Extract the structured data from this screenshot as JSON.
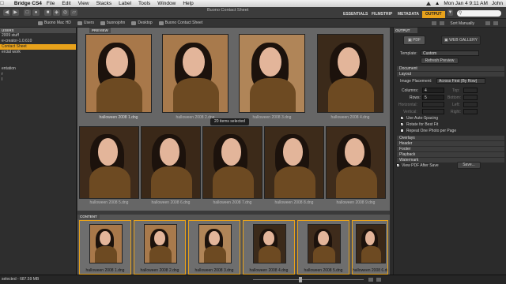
{
  "menubar": {
    "app_name": "Bridge CS4",
    "items": [
      "File",
      "Edit",
      "View",
      "Stacks",
      "Label",
      "Tools",
      "Window",
      "Help"
    ],
    "clock": "Mon Jan 4  9:11 AM",
    "user": "John"
  },
  "toolbar": {
    "window_title": "Buono Contact Sheet",
    "workspaces": [
      "ESSENTIALS",
      "FILMSTRIP",
      "METADATA",
      "OUTPUT"
    ],
    "active_workspace": "OUTPUT",
    "accent": "#e8a21b"
  },
  "pathbar": {
    "crumbs": [
      "Buono Mac HD",
      "Users",
      "buonojohn",
      "Desktop",
      "Buono Contact Sheet"
    ],
    "sort_label": "Sort Manually"
  },
  "left_panel": {
    "tab_label": "USERS",
    "items": [
      "2009 stuff",
      "e-creator-1.0.610",
      "Contact Sheet",
      "ercial work",
      "",
      "",
      "entation",
      "r",
      "l"
    ],
    "selected_index": 2
  },
  "preview": {
    "tab_label": "PREVIEW",
    "selection_count": "20 items selected",
    "top_captions": [
      "halloween 2008 1.dng",
      "halloween 2008 2.dng",
      "halloween 2008 3.dng",
      "halloween 2008 4.dng"
    ],
    "bottom_captions": [
      "halloween 2008 5.dng",
      "halloween 2008 6.dng",
      "halloween 2008 7.dng",
      "halloween 2008 8.dng",
      "halloween 2008 9.dng"
    ]
  },
  "content": {
    "tab_label": "CONTENT",
    "captions": [
      "halloween 2008 1.dng",
      "halloween 2008 2.dng",
      "halloween 2008 3.dng",
      "halloween 2008 4.dng",
      "halloween 2008 5.dng",
      "halloween 2008 6.dng"
    ]
  },
  "output": {
    "tab_label": "OUTPUT",
    "pdf_label": "PDF",
    "web_gallery_label": "WEB GALLERY",
    "template_label": "Template:",
    "template_value": "Custom",
    "refresh_label": "Refresh Preview",
    "document_label": "Document",
    "layout_label": "Layout",
    "image_placement_label": "Image Placement:",
    "image_placement_value": "Across First (By Row)",
    "columns_label": "Columns:",
    "columns_value": "4",
    "rows_label": "Rows:",
    "rows_value": "5",
    "hspacing_label": "Horizontal:",
    "vspacing_label": "Vertical:",
    "top_label": "Top:",
    "bottom_label": "Bottom:",
    "left_label": "Left:",
    "right_label": "Right:",
    "auto_spacing_label": "Use Auto-Spacing",
    "rotate_label": "Rotate for Best Fit",
    "repeat_label": "Repeat One Photo per Page",
    "overlays_label": "Overlays",
    "header_label": "Header",
    "footer_label": "Footer",
    "playback_label": "Playback",
    "watermark_label": "Watermark",
    "view_pdf_label": "View PDF After Save",
    "save_label": "Save..."
  },
  "status": {
    "text": "selected - 687.59 MB"
  }
}
